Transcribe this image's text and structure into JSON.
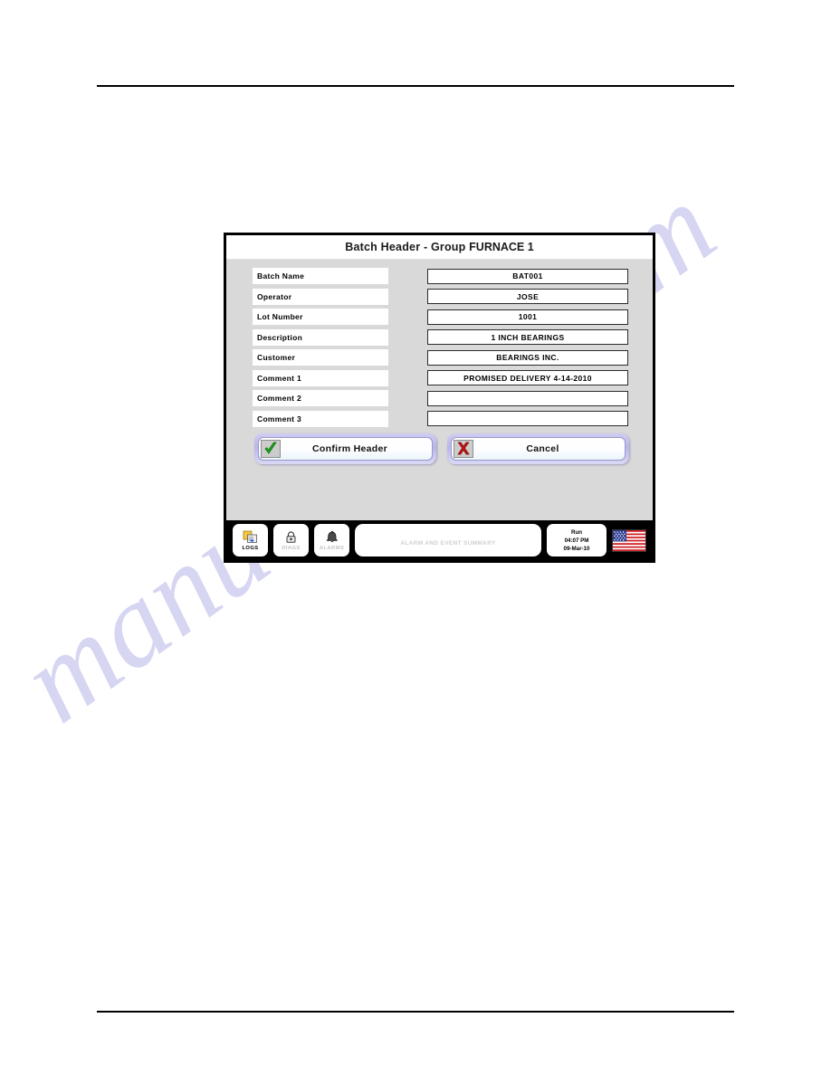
{
  "document": {
    "watermark_text": "manualslive.com"
  },
  "panel": {
    "title_main": "Batch Header  -  Group ",
    "title_group": "FURNACE 1"
  },
  "form": {
    "fields": [
      {
        "label": "Batch Name",
        "value": "BAT001"
      },
      {
        "label": "Operator",
        "value": "JOSE"
      },
      {
        "label": "Lot Number",
        "value": "1001"
      },
      {
        "label": "Description",
        "value": "1 INCH BEARINGS"
      },
      {
        "label": "Customer",
        "value": "BEARINGS INC."
      },
      {
        "label": "Comment 1",
        "value": "PROMISED DELIVERY 4-14-2010"
      },
      {
        "label": "Comment 2",
        "value": ""
      },
      {
        "label": "Comment 3",
        "value": ""
      }
    ]
  },
  "buttons": {
    "confirm": {
      "label": "Confirm Header",
      "icon": "green-check-icon",
      "color": "#1ea91e"
    },
    "cancel": {
      "label": "Cancel",
      "icon": "red-x-icon",
      "color": "#cc1111"
    }
  },
  "toolbar": {
    "logs": {
      "label": "LOGS",
      "icon": "logs-icon",
      "enabled": true
    },
    "diags": {
      "label": "DIAGS",
      "icon": "lock-icon",
      "enabled": false
    },
    "alarms": {
      "label": "ALARMS",
      "icon": "bell-icon",
      "enabled": false
    },
    "alarm_summary": {
      "label": "ALARM AND EVENT SUMMARY"
    },
    "status": {
      "mode": "Run",
      "time": "04:07 PM",
      "date": "09-Mar-10"
    },
    "flag": {
      "icon": "us-flag-icon"
    }
  }
}
